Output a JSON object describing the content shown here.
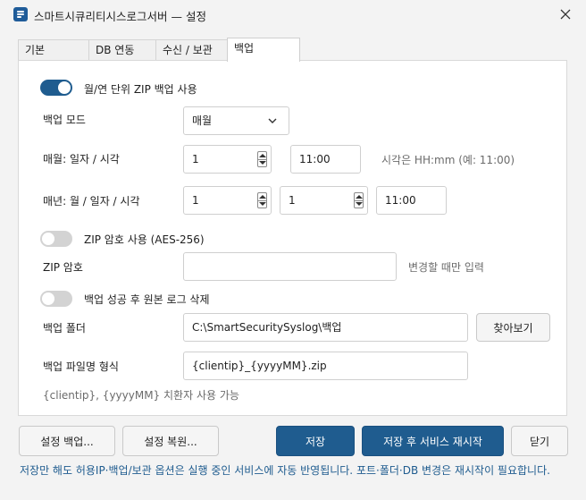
{
  "window": {
    "title": "스마트시큐리티시스로그서버 — 설정",
    "accent": "#1f5c8f"
  },
  "tabs": [
    {
      "label": "기본",
      "active": false
    },
    {
      "label": "DB 연동",
      "active": false
    },
    {
      "label": "수신 / 보관",
      "active": false
    },
    {
      "label": "백업",
      "active": true
    }
  ],
  "backup": {
    "zip_toggle_label": "월/연 단위 ZIP 백업 사용",
    "zip_toggle_on": true,
    "mode_label": "백업 모드",
    "mode_value": "매월",
    "monthly_label": "매월: 일자 / 시각",
    "monthly_day": "1",
    "monthly_time": "11:00",
    "time_hint": "시각은 HH:mm (예: 11:00)",
    "yearly_label": "매년: 월 / 일자 / 시각",
    "yearly_month": "1",
    "yearly_day": "1",
    "yearly_time": "11:00",
    "zip_password_toggle_label": "ZIP 암호 사용 (AES-256)",
    "zip_password_toggle_on": false,
    "zip_password_label": "ZIP 암호",
    "zip_password_value": "",
    "zip_password_hint": "변경할 때만 입력",
    "delete_toggle_label": "백업 성공 후 원본 로그 삭제",
    "delete_toggle_on": false,
    "folder_label": "백업 폴더",
    "folder_value": "C:\\SmartSecuritySyslog\\백업",
    "browse_button": "찾아보기",
    "filename_label": "백업 파일명 형식",
    "filename_value": "{clientip}_{yyyyMM}.zip",
    "filename_hint": "{clientip}, {yyyyMM} 치환자 사용 가능"
  },
  "footer": {
    "backup_settings_button": "설정 백업...",
    "restore_settings_button": "설정 복원...",
    "save_button": "저장",
    "save_restart_button": "저장 후 서비스 재시작",
    "close_button": "닫기",
    "note": "저장만 해도 허용IP·백업/보관 옵션은 실행 중인 서비스에 자동 반영됩니다. 포트·폴더·DB 변경은 재시작이 필요합니다."
  }
}
